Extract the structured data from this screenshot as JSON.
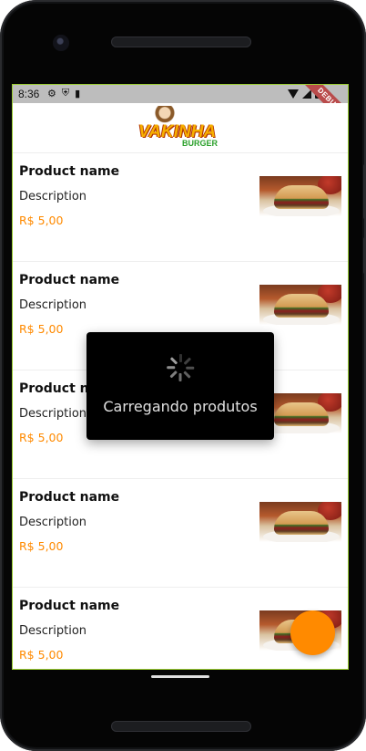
{
  "status_bar": {
    "time": "8:36",
    "left_icons": [
      "gear-icon",
      "shield-icon",
      "sd-card-icon"
    ],
    "right_icons": [
      "wifi-icon",
      "signal-icon",
      "battery-icon"
    ],
    "debug_banner": "DEBUG"
  },
  "app_bar": {
    "logo_main": "VAKINHA",
    "logo_sub": "BURGER"
  },
  "products": [
    {
      "name": "Product name",
      "description": "Description",
      "price": "R$ 5,00"
    },
    {
      "name": "Product name",
      "description": "Description",
      "price": "R$ 5,00"
    },
    {
      "name": "Product name",
      "description": "Description",
      "price": "R$ 5,00"
    },
    {
      "name": "Product name",
      "description": "Description",
      "price": "R$ 5,00"
    },
    {
      "name": "Product name",
      "description": "Description",
      "price": "R$ 5,00"
    }
  ],
  "loading": {
    "message": "Carregando produtos"
  },
  "colors": {
    "accent": "#ff8a00",
    "overlay": "#000000",
    "status_bar": "#bdbdbd"
  }
}
